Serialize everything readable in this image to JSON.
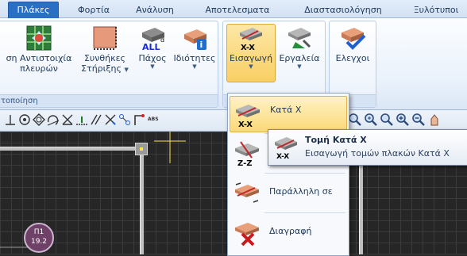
{
  "tabs": [
    {
      "label": "Πλάκες",
      "active": true
    },
    {
      "label": "Φορτία"
    },
    {
      "label": "Ανάλυση"
    },
    {
      "label": "Αποτελεσματα"
    },
    {
      "label": "Διαστασιολόγηση"
    },
    {
      "label": "Ξυλότυποι"
    }
  ],
  "ribbon": {
    "group1": {
      "label": "τοποίηση",
      "buttons": [
        {
          "label_line1": "ση Αντιστοιχία",
          "label_line2": "πλευρών",
          "icon": "slab-grid-icon"
        },
        {
          "label_line1": "Συνθήκες",
          "label_line2": "Στήριξης",
          "icon": "support-conditions-icon"
        },
        {
          "label_line1": "Πάχος",
          "label_line2": "",
          "icon": "thickness-all-icon",
          "badge": "ALL"
        },
        {
          "label_line1": "Ιδιότητες",
          "label_line2": "",
          "icon": "properties-icon",
          "badge": "i"
        }
      ]
    },
    "group2": {
      "buttons": [
        {
          "label": "Εισαγωγή",
          "icon": "section-insert-icon",
          "badge": "X-X"
        },
        {
          "label": "Εργαλεία",
          "icon": "section-tools-icon"
        }
      ]
    },
    "group3": {
      "buttons": [
        {
          "label": "Ελεγχοι",
          "icon": "check-icon"
        }
      ]
    }
  },
  "toolbar": {
    "abs_label": "ABS"
  },
  "canvas": {
    "marker_label": "Π1",
    "marker_value": "19.2"
  },
  "menu": {
    "items": [
      {
        "label": "Κατά Χ",
        "badge": "X-X",
        "highlighted": true
      },
      {
        "label": "",
        "badge": "Z-Z"
      },
      {
        "label": "Παράλληλη σε",
        "badge": ""
      },
      {
        "label": "Διαγραφή",
        "badge": ""
      }
    ]
  },
  "tooltip": {
    "title": "Τομή Κατά Χ",
    "description": "Εισαγωγή τομών πλακών  Κατά Χ",
    "badge": "X-X"
  },
  "colors": {
    "active_tab": "#2a6fc6",
    "highlight": "#fbd977",
    "canvas_bg": "#262626",
    "marker": "#6f4168"
  }
}
